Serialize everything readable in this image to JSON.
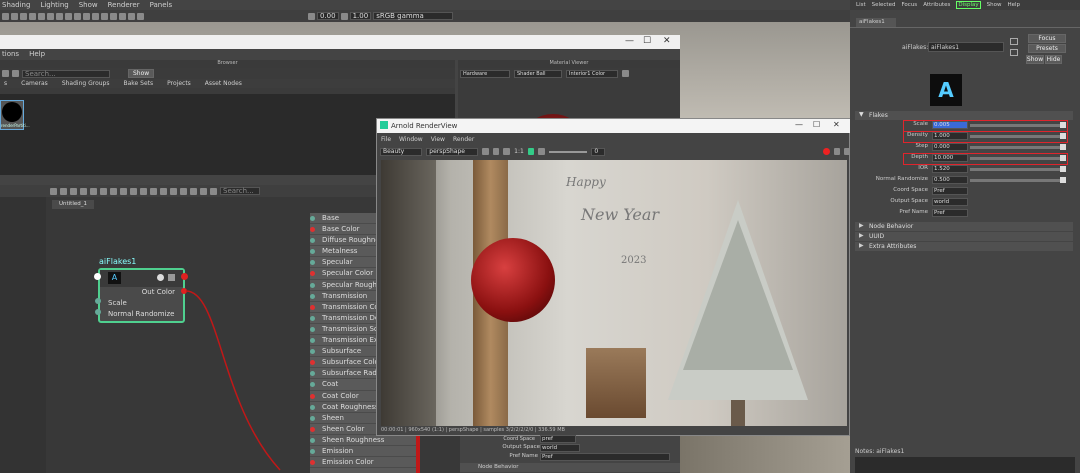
{
  "main_menu": [
    "Shading",
    "Lighting",
    "Show",
    "Renderer",
    "Panels"
  ],
  "toolbar": {
    "value1": "0.00",
    "value2": "1.00",
    "colorspace": "sRGB gamma"
  },
  "hypershade": {
    "menu": [
      "tions",
      "Help"
    ],
    "browser_title": "Browser",
    "material_viewer_title": "Material Viewer",
    "search_placeholder": "Search...",
    "show_label": "Show",
    "tabs": [
      "s",
      "Cameras",
      "Shading Groups",
      "Bake Sets",
      "Projects",
      "Asset Nodes"
    ],
    "thumb_label": "renderPartiti...",
    "viewer_options": [
      "Hardware",
      "Shader Ball",
      "Interior1 Color"
    ],
    "graph_tab": "Untitled_1",
    "graph_search_placeholder": "Search...",
    "node": {
      "name": "aiFlakes1",
      "out": "Out Color",
      "attrs": [
        "Scale",
        "Normal Randomize"
      ]
    },
    "material_attrs": [
      "Base",
      "Base Color",
      "Diffuse Roughness",
      "Metalness",
      "Specular",
      "Specular Color",
      "Specular Roughness",
      "Transmission",
      "Transmission Color",
      "Transmission Depth",
      "Transmission Scatter",
      "Transmission Extra",
      "Subsurface",
      "Subsurface Color",
      "Subsurface Radius",
      "Coat",
      "Coat Color",
      "Coat Roughness",
      "Sheen",
      "Sheen Color",
      "Sheen Roughness",
      "Emission",
      "Emission Color"
    ]
  },
  "render_view": {
    "title": "Arnold RenderView",
    "menu": [
      "File",
      "Window",
      "View",
      "Render"
    ],
    "mode": "Beauty",
    "camera": "perspShape",
    "ratio": "1:1",
    "exposure": "0",
    "status": "00:00:01 | 960x540 (1:1) | perspShape | samples 3/2/2/2/2/0 | 336.59 MB",
    "under_attrs": [
      {
        "label": "Coord Space",
        "value": "pref"
      },
      {
        "label": "Output Space",
        "value": "world"
      },
      {
        "label": "Pref Name",
        "value": "Pref"
      }
    ],
    "under_section": "Node Behavior",
    "scene_text": [
      "Happy",
      "New Year",
      "2023"
    ]
  },
  "attribute_editor": {
    "menu": [
      "List",
      "Selected",
      "Focus",
      "Attributes",
      "Display",
      "Show",
      "Help"
    ],
    "tab": "aiFlakes1",
    "node_label": "aiFlakes:",
    "node_value": "aiFlakes1",
    "buttons": {
      "focus": "Focus",
      "presets": "Presets",
      "show": "Show",
      "hide": "Hide"
    },
    "section_main": "Flakes",
    "attrs": [
      {
        "label": "Scale",
        "value": "0.005"
      },
      {
        "label": "Density",
        "value": "1.000"
      },
      {
        "label": "Step",
        "value": "0.000"
      },
      {
        "label": "Depth",
        "value": "10.000"
      },
      {
        "label": "IOR",
        "value": "1.520"
      },
      {
        "label": "Normal Randomize",
        "value": "0.500"
      },
      {
        "label": "Coord Space",
        "value": "Pref"
      },
      {
        "label": "Output Space",
        "value": "world"
      },
      {
        "label": "Pref Name",
        "value": "Pref"
      }
    ],
    "sections": [
      "Node Behavior",
      "UUID",
      "Extra Attributes"
    ],
    "notes": "Notes:  aiFlakes1",
    "accent": "#e0242c"
  }
}
